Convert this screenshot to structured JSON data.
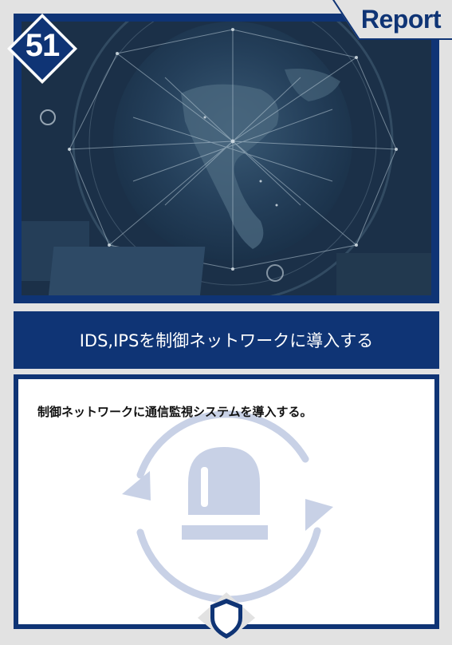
{
  "card": {
    "number": "51",
    "category_tab": "Report",
    "title": "IDS,IPSを制御ネットワークに導入する",
    "description": "制御ネットワークに通信監視システムを導入する。"
  },
  "icons": {
    "badge": "diamond-number-badge",
    "graphic": "alarm-light-refresh-icon",
    "footer": "shield-icon"
  },
  "colors": {
    "primary": "#0f3475",
    "background": "#e2e2e2",
    "graphic": "#c8d1e6"
  }
}
